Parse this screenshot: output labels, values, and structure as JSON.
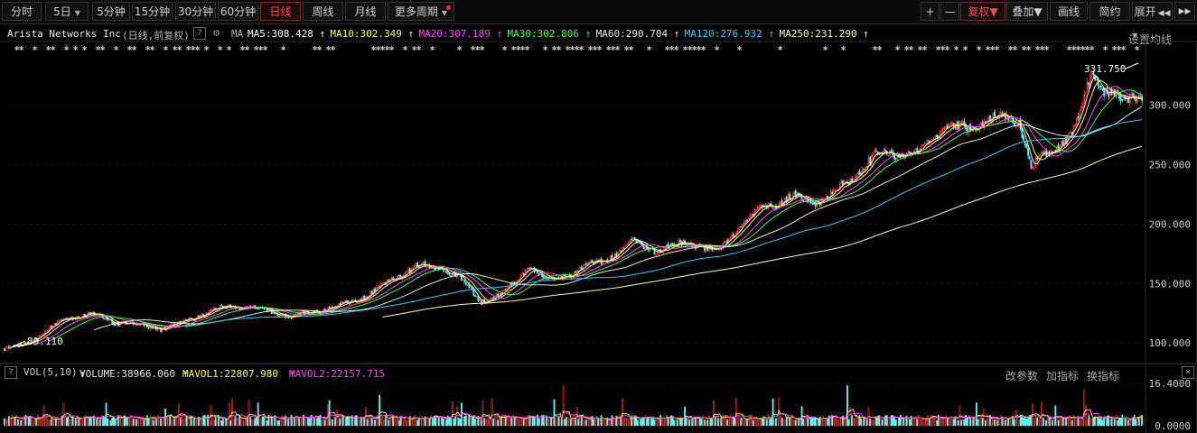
{
  "toolbar": {
    "tabs": [
      {
        "label": "分时",
        "has_caret": false,
        "active": false
      },
      {
        "label": "5日",
        "has_caret": true,
        "active": false
      },
      {
        "label": "5分钟",
        "has_caret": false,
        "active": false
      },
      {
        "label": "15分钟",
        "has_caret": false,
        "active": false
      },
      {
        "label": "30分钟",
        "has_caret": false,
        "active": false
      },
      {
        "label": "60分钟",
        "has_caret": false,
        "active": false
      },
      {
        "label": "日线",
        "has_caret": false,
        "active": true
      },
      {
        "label": "周线",
        "has_caret": false,
        "active": false
      },
      {
        "label": "月线",
        "has_caret": false,
        "active": false
      },
      {
        "label": "更多周期",
        "has_caret": true,
        "active": false
      }
    ],
    "right": {
      "plus": "+",
      "minus": "—",
      "fuquan": "复权",
      "diejia": "叠加",
      "huaxian": "画线",
      "jianyue": "简约",
      "zhankai": "展开"
    }
  },
  "info": {
    "name": "Arista Networks Inc",
    "mode": "(日线,前复权)",
    "q": "?",
    "ma_label": "MA",
    "ma_items": [
      {
        "text": "MA5:308.428",
        "arrow": "↑",
        "color": "#ffffff"
      },
      {
        "text": "MA10:302.349",
        "arrow": "↑",
        "color": "#ffff4d"
      },
      {
        "text": "MA20:307.189",
        "arrow": "↑",
        "color": "#ff44ff"
      },
      {
        "text": "MA30:302.806",
        "arrow": "↑",
        "color": "#44ff44"
      },
      {
        "text": "MA60:290.704",
        "arrow": "↑",
        "color": "#eaeaea"
      },
      {
        "text": "MA120:276.932",
        "arrow": "↑",
        "color": "#33ccff"
      },
      {
        "text": "MA250:231.290",
        "arrow": "↑",
        "color": "#ffffaa"
      }
    ],
    "settings": "设置均线"
  },
  "price_axis": {
    "ticks": [
      "300.000",
      "250.000",
      "200.000",
      "150.000",
      "100.000"
    ]
  },
  "annotations": {
    "high": "331.750",
    "low": "89.110"
  },
  "volume": {
    "q": "?",
    "label": "VOL(5,10)",
    "volume": "VOLUME:38966.060",
    "volume_arrow": "↑",
    "mavol1": "MAVOL1:22807.980",
    "mavol1_arrow": "↑",
    "mavol2": "MAVOL2:22157.715",
    "mavol2_arrow": "↑",
    "btn_params": "改参数",
    "btn_add": "加指标",
    "btn_switch": "换指标",
    "close": "✕",
    "ticks": [
      "16.4000",
      "0.0000"
    ]
  },
  "colors": {
    "up": "#ff3232",
    "down": "#54ffff",
    "bg": "#000000",
    "ma5": "#ffffff",
    "ma10": "#ffff4d",
    "ma20": "#ff44ff",
    "ma30": "#44ff44",
    "ma60": "#eaeaea",
    "ma120": "#33ccff",
    "ma250": "#ffffaa"
  },
  "chart_data": {
    "type": "line",
    "ylim": [
      85,
      340
    ],
    "y_ticks": [
      300,
      250,
      200,
      150,
      100
    ],
    "anchors": [
      [
        0,
        95
      ],
      [
        12,
        98
      ],
      [
        40,
        120
      ],
      [
        55,
        125
      ],
      [
        72,
        118
      ],
      [
        90,
        115
      ],
      [
        105,
        112
      ],
      [
        130,
        124
      ],
      [
        150,
        132
      ],
      [
        170,
        128
      ],
      [
        190,
        122
      ],
      [
        210,
        128
      ],
      [
        230,
        135
      ],
      [
        252,
        150
      ],
      [
        270,
        165
      ],
      [
        288,
        163
      ],
      [
        300,
        155
      ],
      [
        313,
        135
      ],
      [
        330,
        142
      ],
      [
        345,
        165
      ],
      [
        358,
        152
      ],
      [
        375,
        160
      ],
      [
        395,
        170
      ],
      [
        415,
        185
      ],
      [
        430,
        178
      ],
      [
        450,
        186
      ],
      [
        468,
        175
      ],
      [
        480,
        192
      ],
      [
        500,
        215
      ],
      [
        520,
        222
      ],
      [
        540,
        220
      ],
      [
        560,
        242
      ],
      [
        580,
        262
      ],
      [
        600,
        258
      ],
      [
        618,
        280
      ],
      [
        635,
        280
      ],
      [
        650,
        290
      ],
      [
        668,
        288
      ],
      [
        676,
        248
      ],
      [
        690,
        262
      ],
      [
        705,
        280
      ],
      [
        716,
        328
      ],
      [
        728,
        310
      ],
      [
        738,
        300
      ],
      [
        748,
        312
      ]
    ],
    "vol_ylim": [
      0,
      16.4
    ],
    "vol_ticks": [
      "16.4000",
      "0.0000"
    ],
    "ma_last": {
      "MA5": 308.428,
      "MA10": 302.349,
      "MA20": 307.189,
      "MA30": 302.806,
      "MA60": 290.704,
      "MA120": 276.932,
      "MA250": 231.29
    },
    "high": 331.75,
    "low": 89.11
  }
}
